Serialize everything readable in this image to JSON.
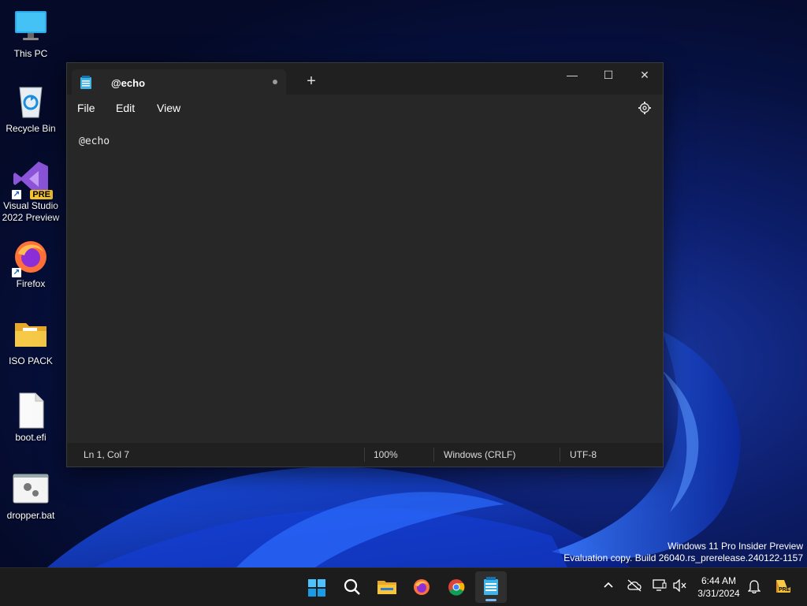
{
  "desktop": {
    "icons": [
      {
        "label": "This PC",
        "icon": "monitor-icon"
      },
      {
        "label": "Recycle Bin",
        "icon": "recycle-bin-icon"
      },
      {
        "label": "Visual Studio 2022 Preview",
        "icon": "visual-studio-icon",
        "badge": "PRE"
      },
      {
        "label": "Firefox",
        "icon": "firefox-icon"
      },
      {
        "label": "ISO PACK",
        "icon": "folder-icon"
      },
      {
        "label": "boot.efi",
        "icon": "file-icon"
      },
      {
        "label": "dropper.bat",
        "icon": "batch-file-icon"
      }
    ],
    "watermark": {
      "line1": "Windows 11 Pro Insider Preview",
      "line2": "Evaluation copy. Build 26040.rs_prerelease.240122-1157"
    }
  },
  "notepad": {
    "tab_title": "@echo",
    "new_tab_label": "+",
    "window_controls": {
      "minimize": "—",
      "maximize": "☐",
      "close": "✕"
    },
    "menu": {
      "file": "File",
      "edit": "Edit",
      "view": "View"
    },
    "content": "@echo",
    "status": {
      "position": "Ln 1, Col 7",
      "zoom": "100%",
      "line_ending": "Windows (CRLF)",
      "encoding": "UTF-8"
    }
  },
  "taskbar": {
    "apps": [
      "start-icon",
      "search-icon",
      "file-explorer-icon",
      "firefox-icon",
      "chrome-icon",
      "notepad-icon"
    ],
    "clock": {
      "time": "6:44 AM",
      "date": "3/31/2024"
    },
    "tray": [
      "chevron-up-icon",
      "cloud-off-icon",
      "display-icon",
      "volume-muted-icon",
      "bell-icon",
      "copilot-icon"
    ],
    "copilot_badge": "PRE"
  },
  "colors": {
    "window_bg": "#272727",
    "titlebar_bg": "#202020",
    "accent": "#76b9ed"
  }
}
